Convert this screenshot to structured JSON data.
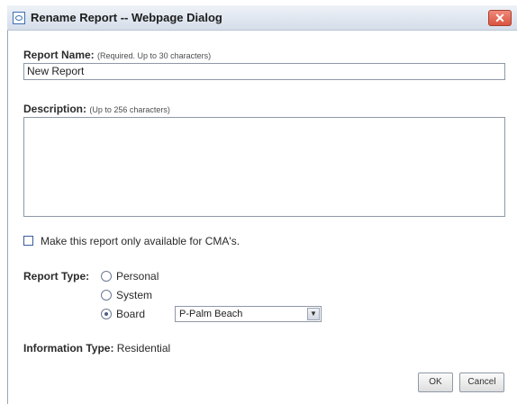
{
  "window": {
    "title": "Rename Report -- Webpage Dialog",
    "close_label": "✕"
  },
  "form": {
    "report_name": {
      "label": "Report Name:",
      "hint": "(Required. Up to 30 characters)",
      "value": "New Report"
    },
    "description": {
      "label": "Description:",
      "hint": "(Up to 256 characters)",
      "value": ""
    },
    "cma_only": {
      "label": "Make this report only available for CMA's.",
      "checked": false
    },
    "report_type": {
      "label": "Report Type:",
      "options": [
        "Personal",
        "System",
        "Board"
      ],
      "selected": "Board",
      "board_select_value": "P-Palm Beach"
    },
    "information_type": {
      "label": "Information Type:",
      "value": "Residential"
    }
  },
  "buttons": {
    "ok": "OK",
    "cancel": "Cancel"
  },
  "colors": {
    "titlebar": "#d5dde9",
    "close": "#d9533f",
    "border": "#8e98a6"
  }
}
